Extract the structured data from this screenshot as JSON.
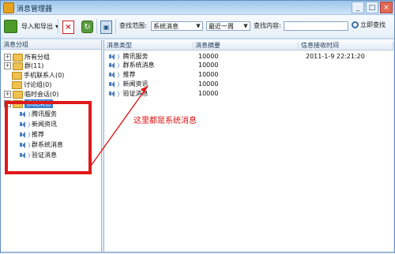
{
  "window": {
    "title": "消息管理器",
    "controls": [
      "_",
      "□",
      "×"
    ]
  },
  "toolbar": {
    "import_export_label": "导入和导出",
    "search_scope_label": "查找范围:",
    "scope_value": "系统消息",
    "period_value": "最近一周",
    "search_content_label": "查找内容:",
    "search_input_value": "",
    "search_button_label": "立即查找"
  },
  "left_panel": {
    "header": "消息分组",
    "groups": [
      {
        "label": "所有分组"
      },
      {
        "label": "群(11)"
      },
      {
        "label": "手机联系人(0)"
      },
      {
        "label": "讨论组(0)"
      },
      {
        "label": "临时会话(0)"
      },
      {
        "label": "系统消息"
      }
    ],
    "system_children": [
      "腾讯服务",
      "新闻资讯",
      "推荐",
      "群系统消息",
      "验证消息"
    ]
  },
  "right_panel": {
    "columns": [
      "消息类型",
      "消息摘要",
      "信息接收时间"
    ],
    "rows": [
      {
        "type": "腾讯服务",
        "summary": "10000",
        "time": "2011-1-9 22:21:20"
      },
      {
        "type": "群系统消息",
        "summary": "10000",
        "time": ""
      },
      {
        "type": "推荐",
        "summary": "10000",
        "time": ""
      },
      {
        "type": "新闻资讯",
        "summary": "10000",
        "time": ""
      },
      {
        "type": "验证消息",
        "summary": "10000",
        "time": ""
      }
    ]
  },
  "annotation": {
    "text": "这里都是系统消息",
    "color": "#e01818"
  }
}
